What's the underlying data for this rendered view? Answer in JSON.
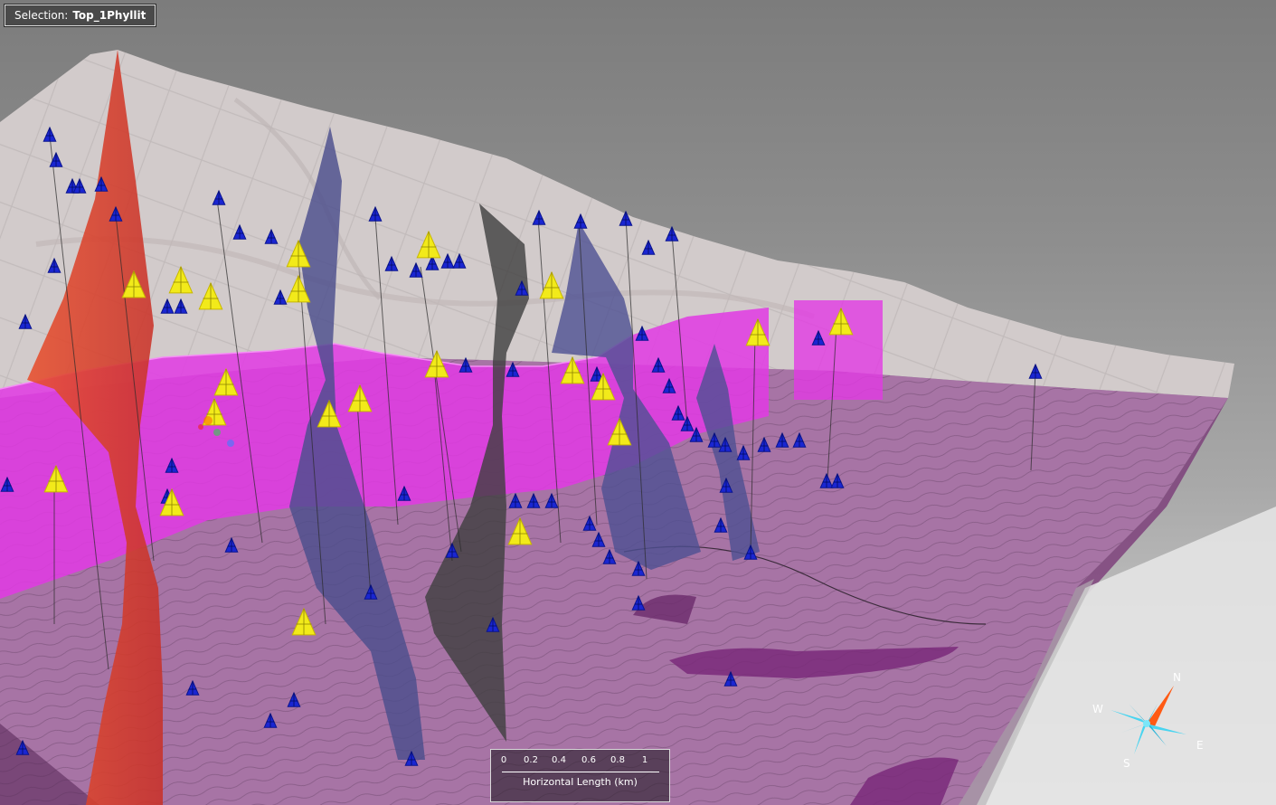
{
  "selection": {
    "label": "Selection:",
    "value": "Top_1Phyllit"
  },
  "scale_bar": {
    "ticks": [
      "0",
      "0.2",
      "0.4",
      "0.6",
      "0.8",
      "1"
    ],
    "title": "Horizontal Length (km)"
  },
  "compass": {
    "north": "N",
    "south": "S",
    "east": "E",
    "west": "W"
  },
  "colors": {
    "background": "#8e8e8e",
    "terrain_upper": "#d6cfcf",
    "terrain_lower": "#a872a6",
    "horizon_surface": "#e43ae6",
    "fault_red": "#e0482c",
    "fault_blue": "#4c4e8c",
    "fault_dark": "#3c3c3c",
    "well_blue": "#1a26d2",
    "well_yellow": "#f2ea1a",
    "compass_north": "#ff5a14",
    "compass_body": "#48d4f0"
  },
  "icons": [
    "well-marker-icon",
    "compass-rose-icon"
  ]
}
